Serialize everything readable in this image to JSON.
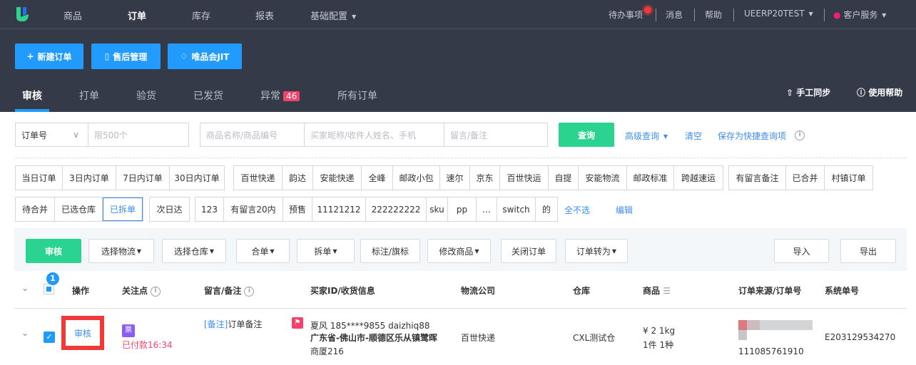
{
  "topnav": {
    "items": [
      "商品",
      "订单",
      "库存",
      "报表",
      "基础配置"
    ],
    "active": "订单",
    "right": {
      "todo": "待办事项",
      "messages": "消息",
      "help": "帮助",
      "account": "UEERP20TEST",
      "service": "客户服务"
    }
  },
  "actions": {
    "new_order": "新建订单",
    "after_sale": "售后管理",
    "vip_jit": "唯品会JIT"
  },
  "tabs": [
    {
      "label": "审核",
      "active": true
    },
    {
      "label": "打单"
    },
    {
      "label": "验货"
    },
    {
      "label": "已发货"
    },
    {
      "label": "异常",
      "badge": "46"
    },
    {
      "label": "所有订单"
    }
  ],
  "tab_actions": {
    "sync": "手工同步",
    "help": "使用帮助"
  },
  "search": {
    "type_select": "订单号",
    "order_no_placeholder": "限500个",
    "product_placeholder": "商品名称/商品编号",
    "buyer_placeholder": "买家昵称/收件人姓名、手机",
    "remark_placeholder": "留言/备注",
    "query": "查询",
    "advanced": "高级查询",
    "clear": "清空",
    "save_quick": "保存为快捷查询项"
  },
  "tag_groups": {
    "date": [
      "当日订单",
      "3日内订单",
      "7日内订单",
      "30日内订单"
    ],
    "logistics": [
      "百世快递",
      "韵达",
      "安能快递",
      "全峰",
      "邮政小包",
      "速尔",
      "京东",
      "百世快运",
      "自提",
      "安能物流",
      "邮政标准",
      "跨越速运"
    ],
    "misc": [
      "有留言备注",
      "已合并",
      "村镇订单"
    ],
    "status": [
      "待合并",
      "已选仓库",
      "已拆单"
    ],
    "status_active": "已拆单",
    "next_day": "次日达",
    "custom": [
      "123",
      "有留言20内",
      "预售",
      "11121212",
      "222222222",
      "sku",
      "pp",
      "...",
      "switch",
      "的"
    ],
    "deselect_all": "全不选",
    "edit": "编辑"
  },
  "toolbar": {
    "audit": "审核",
    "buttons": [
      "选择物流",
      "选择仓库",
      "合单",
      "拆单",
      "标注/旗标",
      "修改商品",
      "关闭订单",
      "订单转为"
    ],
    "import": "导入",
    "export": "导出"
  },
  "table": {
    "selected_count": "1",
    "headers": {
      "action": "操作",
      "focus": "关注点",
      "remark": "留言/备注",
      "buyer": "买家ID/收货信息",
      "logistics": "物流公司",
      "warehouse": "仓库",
      "product": "商品",
      "source": "订单来源/订单号",
      "system_no": "系统单号"
    },
    "rows": [
      {
        "action": "审核",
        "invoice_badge": "票",
        "paid": "已付款16:34",
        "remark_tag": "[备注]",
        "remark": "订单备注",
        "buyer_line1": "夏风 185****9855   daizhiq88",
        "address_line1": "广东省-佛山市-顺德区乐从镇鹭晖",
        "address_line2": "商厦216",
        "logistics": "百世快递",
        "warehouse": "CXL测试仓",
        "price_weight": "¥ 2  1kg",
        "qty": "1件  1种",
        "order_no": "111085761910",
        "system_no": "E203129534270"
      }
    ]
  },
  "colors": {
    "nav_bg": "#343a48",
    "primary": "#229bff",
    "green": "#2ad38f",
    "badge": "#f5426b",
    "link": "#3d8ef0",
    "highlight": "#f03a3a"
  }
}
